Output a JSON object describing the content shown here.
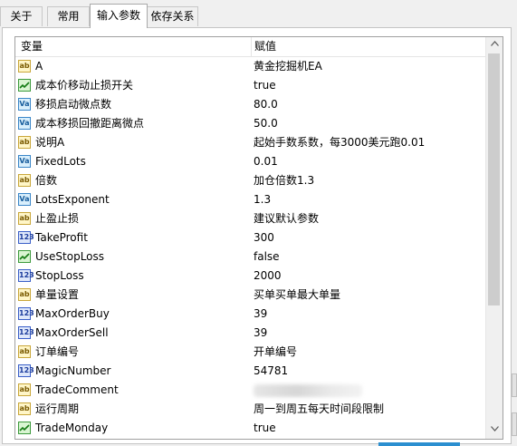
{
  "tabs": [
    {
      "label": "关于",
      "active": false
    },
    {
      "label": "常用",
      "active": false
    },
    {
      "label": "输入参数",
      "active": true
    },
    {
      "label": "依存关系",
      "active": false
    }
  ],
  "table": {
    "columns": [
      "变量",
      "赋值"
    ],
    "rows": [
      {
        "type": "string",
        "icon": "ab",
        "name": "A",
        "value": "黄金挖掘机EA"
      },
      {
        "type": "bool",
        "icon": "bool",
        "name": "成本价移动止损开关",
        "value": "true"
      },
      {
        "type": "double",
        "icon": "Va",
        "name": "移损启动微点数",
        "value": "80.0"
      },
      {
        "type": "double",
        "icon": "Va",
        "name": "成本移损回撤距离微点",
        "value": "50.0"
      },
      {
        "type": "string",
        "icon": "ab",
        "name": "说明A",
        "value": "起始手数系数，每3000美元跑0.01"
      },
      {
        "type": "double",
        "icon": "Va",
        "name": "FixedLots",
        "value": "0.01"
      },
      {
        "type": "string",
        "icon": "ab",
        "name": "倍数",
        "value": "加仓倍数1.3"
      },
      {
        "type": "double",
        "icon": "Va",
        "name": "LotsExponent",
        "value": "1.3"
      },
      {
        "type": "string",
        "icon": "ab",
        "name": "止盈止损",
        "value": "建议默认参数"
      },
      {
        "type": "int",
        "icon": "123",
        "name": "TakeProfit",
        "value": "300"
      },
      {
        "type": "bool",
        "icon": "bool",
        "name": "UseStopLoss",
        "value": "false"
      },
      {
        "type": "int",
        "icon": "123",
        "name": "StopLoss",
        "value": "2000"
      },
      {
        "type": "string",
        "icon": "ab",
        "name": "单量设置",
        "value": "买单买单最大单量"
      },
      {
        "type": "int",
        "icon": "123",
        "name": "MaxOrderBuy",
        "value": "39"
      },
      {
        "type": "int",
        "icon": "123",
        "name": "MaxOrderSell",
        "value": "39"
      },
      {
        "type": "string",
        "icon": "ab",
        "name": "订单编号",
        "value": "开单编号"
      },
      {
        "type": "int",
        "icon": "123",
        "name": "MagicNumber",
        "value": "54781"
      },
      {
        "type": "string",
        "icon": "ab",
        "name": "TradeComment",
        "value": "",
        "blurred": true
      },
      {
        "type": "string",
        "icon": "ab",
        "name": "运行周期",
        "value": "周一到周五每天时间段限制"
      },
      {
        "type": "bool",
        "icon": "bool",
        "name": "TradeMonday",
        "value": "true"
      }
    ]
  },
  "scrollbar": {
    "up_icon": "chevron-up-icon",
    "down_icon": "chevron-down-icon"
  },
  "colors": {
    "accent": "#2b8fd0",
    "selected_tab_bg": "#ffffff"
  }
}
